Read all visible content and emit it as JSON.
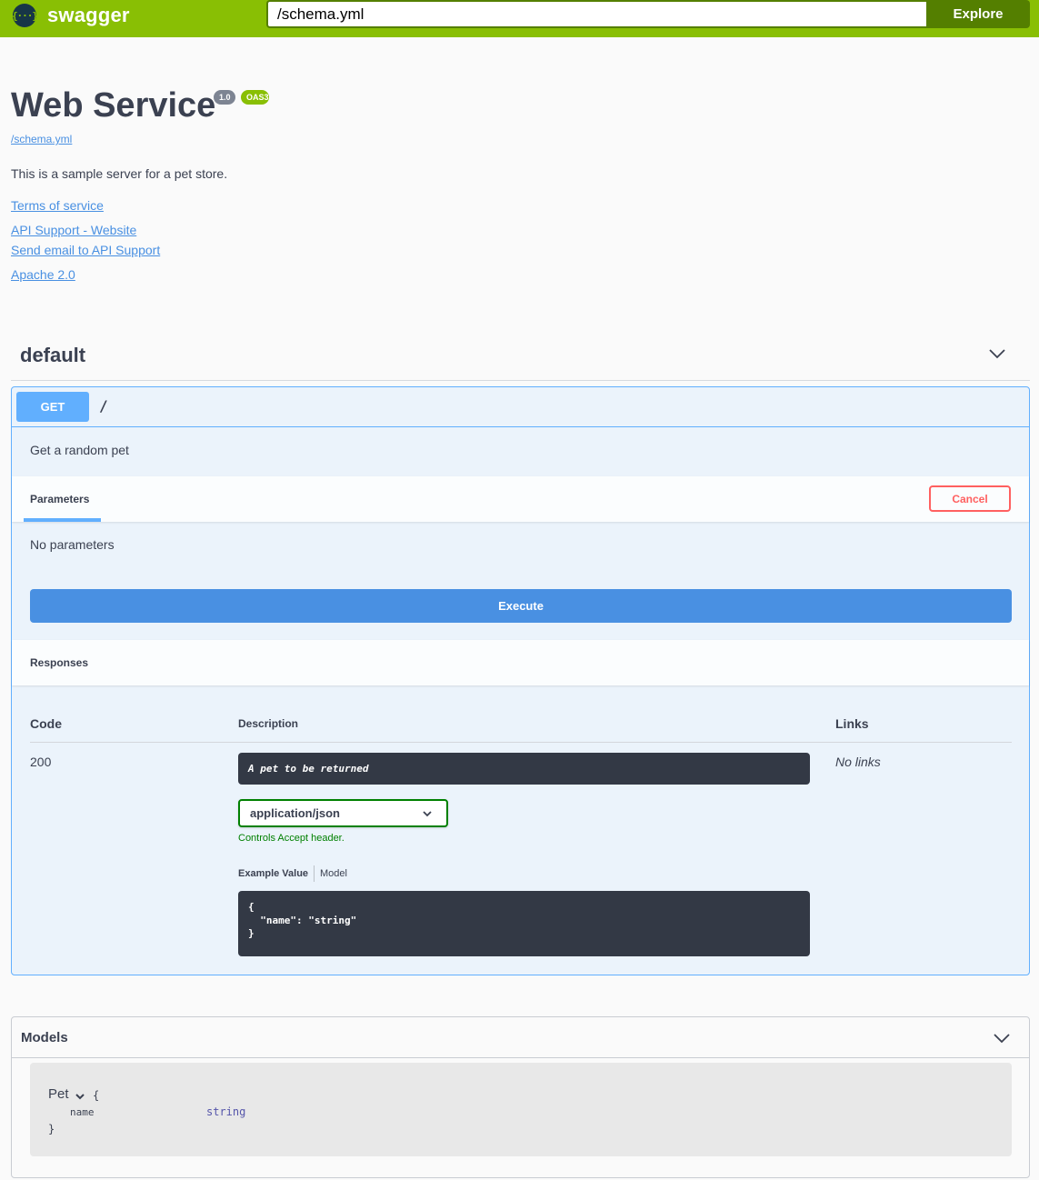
{
  "topbar": {
    "logo_symbol": "{···}",
    "logo_text": "swagger",
    "url_value": "/schema.yml",
    "explore_label": "Explore",
    "brand_color": "#89bf04"
  },
  "info": {
    "title": "Web Service",
    "version": "1.0",
    "oas_badge": "OAS3",
    "spec_url": "/schema.yml",
    "description": "This is a sample server for a pet store.",
    "links": [
      "Terms of service",
      "API Support - Website",
      "Send email to API Support",
      "Apache 2.0"
    ]
  },
  "tag": {
    "name": "default"
  },
  "operation": {
    "method": "GET",
    "path": "/",
    "summary": "Get a random pet",
    "parameters_label": "Parameters",
    "cancel_label": "Cancel",
    "no_params": "No parameters",
    "execute_label": "Execute",
    "responses_label": "Responses",
    "columns": {
      "code": "Code",
      "description": "Description",
      "links": "Links"
    },
    "response": {
      "code": "200",
      "description": "A pet to be returned",
      "media_type": "application/json",
      "controls_accept": "Controls Accept header.",
      "tab_example": "Example Value",
      "tab_model": "Model",
      "example": "{\n  \"name\": \"string\"\n}",
      "links": "No links"
    },
    "method_color": "#61affe"
  },
  "models": {
    "title": "Models",
    "model": {
      "name": "Pet",
      "open_brace": "{",
      "close_brace": "}",
      "property": "name",
      "type": "string"
    }
  }
}
